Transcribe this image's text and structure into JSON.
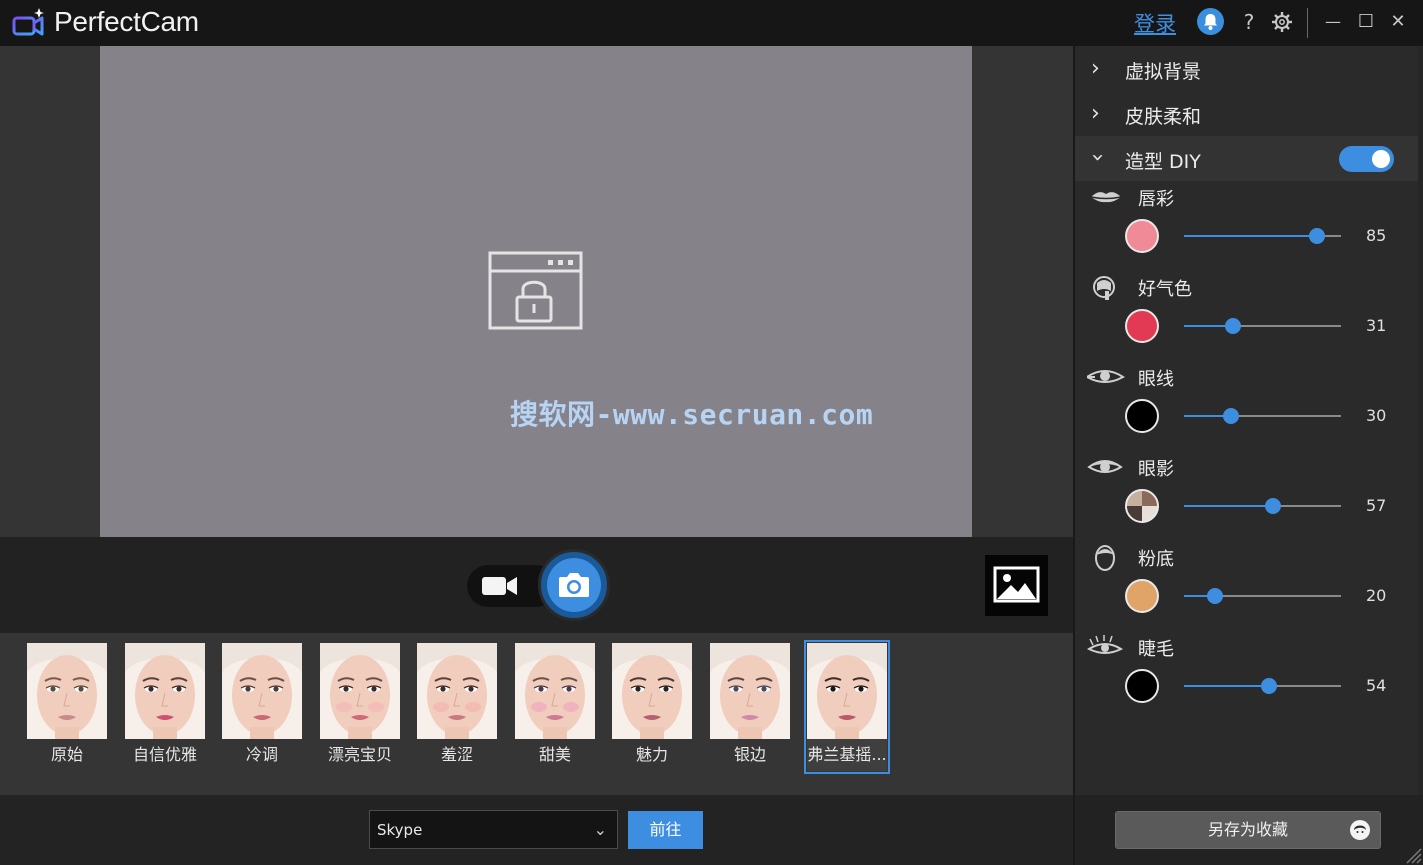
{
  "window": {
    "app_title": "PerfectCam",
    "login_label": "登录",
    "help_label": "?",
    "minimize_label": "—",
    "maximize_label": "☐",
    "close_label": "✕"
  },
  "preview": {
    "watermark": "搜软网-www.secruan.com",
    "lock_icon": "window-lock-icon"
  },
  "capture": {
    "video_icon": "video-camera-icon",
    "photo_icon": "camera-icon",
    "gallery_icon": "image-gallery-icon"
  },
  "presets": [
    {
      "label": "原始",
      "lip": "#c98a8a",
      "brow": "#7a5a48",
      "eye": "#5a4a40",
      "blush": "none"
    },
    {
      "label": "自信优雅",
      "lip": "#d05070",
      "brow": "#5a4038",
      "eye": "#3a2a2a",
      "blush": "none"
    },
    {
      "label": "冷调",
      "lip": "#c86878",
      "brow": "#6a5048",
      "eye": "#4a3a38",
      "blush": "none"
    },
    {
      "label": "漂亮宝贝",
      "lip": "#d06878",
      "brow": "#6a5048",
      "eye": "#3a2a2a",
      "blush": "#f4b6b6"
    },
    {
      "label": "羞涩",
      "lip": "#c87a80",
      "brow": "#5a4038",
      "eye": "#3a2a2a",
      "blush": "#f2b4b0"
    },
    {
      "label": "甜美",
      "lip": "#d07890",
      "brow": "#6a5048",
      "eye": "#4a3a48",
      "blush": "#f0a8c0"
    },
    {
      "label": "魅力",
      "lip": "#b86070",
      "brow": "#4a3530",
      "eye": "#2a2020",
      "blush": "none"
    },
    {
      "label": "银边",
      "lip": "#d08aa8",
      "brow": "#5a4540",
      "eye": "#4a4a58",
      "blush": "none"
    },
    {
      "label": "弗兰基摇...",
      "lip": "#b85a68",
      "brow": "#3a2a28",
      "eye": "#1a1414",
      "blush": "none",
      "selected": true
    }
  ],
  "bottom": {
    "app_select": "Skype",
    "go_label": "前往"
  },
  "panel": {
    "sections": [
      {
        "title": "虚拟背景",
        "expanded": false
      },
      {
        "title": "皮肤柔和",
        "expanded": false
      },
      {
        "title": "造型 DIY",
        "expanded": true,
        "enabled": true
      }
    ],
    "makeup": [
      {
        "label": "唇彩",
        "icon": "lips-icon",
        "color": "#f08a96",
        "value": 85
      },
      {
        "label": "好气色",
        "icon": "blush-brush-icon",
        "color": "#e23a54",
        "value": 31
      },
      {
        "label": "眼线",
        "icon": "eyeliner-icon",
        "color": "#000000",
        "value": 30
      },
      {
        "label": "眼影",
        "icon": "eyeshadow-icon",
        "color": "multi",
        "value": 57
      },
      {
        "label": "粉底",
        "icon": "foundation-face-icon",
        "color": "#e0a468",
        "value": 20
      },
      {
        "label": "睫毛",
        "icon": "eyelash-icon",
        "color": "#000000",
        "value": 54
      }
    ],
    "save_label": "另存为收藏"
  },
  "colors": {
    "accent": "#3d8ee0",
    "preview_gray": "#858289",
    "watermark": "#b8d4f4"
  }
}
